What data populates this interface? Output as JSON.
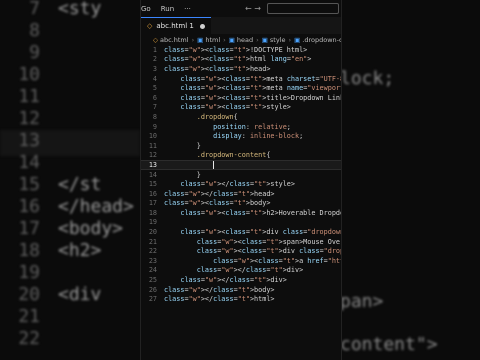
{
  "menubar": {
    "items": [
      "Go",
      "Run",
      "···"
    ]
  },
  "tab": {
    "label": "abc.html 1",
    "icon": "html-icon"
  },
  "breadcrumb": [
    "abc.html",
    "html",
    "head",
    "style",
    ".dropdown-conten"
  ],
  "editor": {
    "active_line": 13,
    "lines": [
      {
        "n": 1,
        "text": "<!DOCTYPE html>"
      },
      {
        "n": 2,
        "text": "<html lang=\"en\">"
      },
      {
        "n": 3,
        "text": "<head>"
      },
      {
        "n": 4,
        "text": "    <meta charset=\"UTF-8\">"
      },
      {
        "n": 5,
        "text": "    <meta name=\"viewport\" content=\"width=devi"
      },
      {
        "n": 6,
        "text": "    <title>Dropdown Links</title>"
      },
      {
        "n": 7,
        "text": "    <style>"
      },
      {
        "n": 8,
        "text": "        .dropdown{"
      },
      {
        "n": 9,
        "text": "            position: relative;"
      },
      {
        "n": 10,
        "text": "            display: inline-block;"
      },
      {
        "n": 11,
        "text": "        }"
      },
      {
        "n": 12,
        "text": "        .dropdown-content{"
      },
      {
        "n": 13,
        "text": "            "
      },
      {
        "n": 14,
        "text": "        }"
      },
      {
        "n": 15,
        "text": "    </style>"
      },
      {
        "n": 16,
        "text": "</head>"
      },
      {
        "n": 17,
        "text": "<body>"
      },
      {
        "n": 18,
        "text": "    <h2>Hoverable Dropdown</h2>"
      },
      {
        "n": 19,
        "text": ""
      },
      {
        "n": 20,
        "text": "    <div class=\"dropdown\">"
      },
      {
        "n": 21,
        "text": "        <span>Mouse Over Me</span>"
      },
      {
        "n": 22,
        "text": "        <div class=\"dropdown-content\">"
      },
      {
        "n": 23,
        "text": "            <a href=\"https://instagram.com/"
      },
      {
        "n": 24,
        "text": "        </div>"
      },
      {
        "n": 25,
        "text": "    </div>"
      },
      {
        "n": 26,
        "text": "</body>"
      },
      {
        "n": 27,
        "text": "</html>"
      }
    ]
  },
  "background": {
    "left_lines": [
      {
        "n": "7",
        "text": "<sty"
      },
      {
        "n": "8",
        "text": ""
      },
      {
        "n": "9",
        "text": ""
      },
      {
        "n": "10",
        "text": ""
      },
      {
        "n": "11",
        "text": ""
      },
      {
        "n": "12",
        "text": ""
      },
      {
        "n": "13",
        "text": ""
      },
      {
        "n": "14",
        "text": ""
      },
      {
        "n": "15",
        "text": "</st"
      },
      {
        "n": "16",
        "text": "</head>"
      },
      {
        "n": "17",
        "text": "<body>"
      },
      {
        "n": "18",
        "text": "<h2>"
      },
      {
        "n": "19",
        "text": ""
      },
      {
        "n": "20",
        "text": "<div"
      },
      {
        "n": "21",
        "text": ""
      },
      {
        "n": "22",
        "text": ""
      }
    ],
    "right_lines": [
      "lock;",
      "pan>",
      "content\">"
    ]
  }
}
